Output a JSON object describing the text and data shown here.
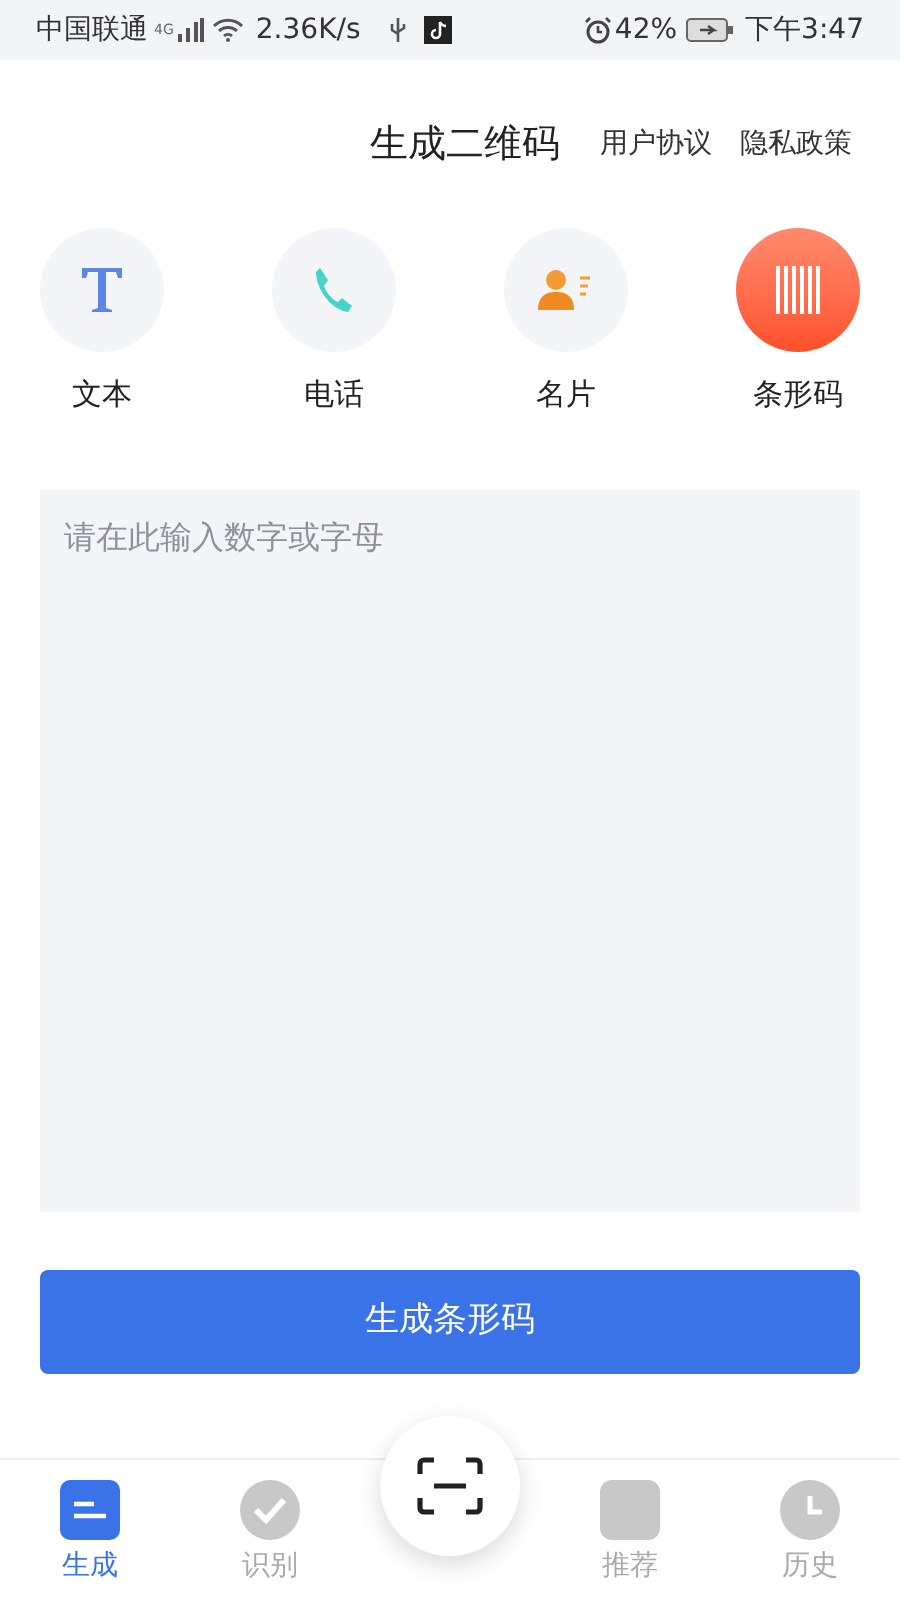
{
  "status_bar": {
    "carrier": "中国联通",
    "network": "4G",
    "speed": "2.36K/s",
    "battery": "42%",
    "time": "下午3:47"
  },
  "header": {
    "title": "生成二维码",
    "links": [
      "用户协议",
      "隐私政策"
    ]
  },
  "types": [
    {
      "kind": "text",
      "label": "文本",
      "selected": false
    },
    {
      "kind": "phone",
      "label": "电话",
      "selected": false
    },
    {
      "kind": "card",
      "label": "名片",
      "selected": false
    },
    {
      "kind": "barcode",
      "label": "条形码",
      "selected": true
    }
  ],
  "input": {
    "placeholder": "请在此输入数字或字母"
  },
  "generate_button": "生成条形码",
  "nav": [
    {
      "kind": "generate",
      "label": "生成",
      "selected": true
    },
    {
      "kind": "scan_result",
      "label": "识别",
      "selected": false
    },
    {
      "kind": "scan"
    },
    {
      "kind": "recommend",
      "label": "推荐",
      "selected": false
    },
    {
      "kind": "history",
      "label": "历史",
      "selected": false
    }
  ]
}
